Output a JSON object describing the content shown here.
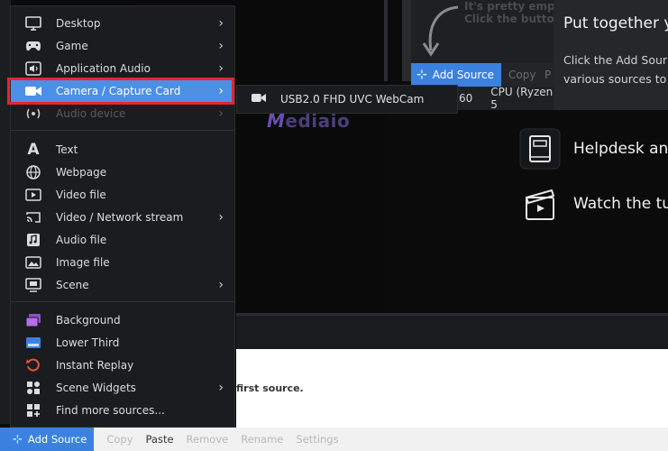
{
  "menu": {
    "items": [
      {
        "label": "Desktop",
        "icon": "monitor-icon",
        "submenu": true
      },
      {
        "label": "Game",
        "icon": "gamepad-icon",
        "submenu": true
      },
      {
        "label": "Application Audio",
        "icon": "speaker-icon",
        "submenu": true
      },
      {
        "label": "Camera / Capture Card",
        "icon": "camera-icon",
        "submenu": true,
        "highlighted": true
      },
      {
        "label": "Audio device",
        "icon": "audio-wave-icon",
        "submenu": true,
        "disabled": true
      },
      {
        "label": "Text",
        "icon": "text-icon"
      },
      {
        "label": "Webpage",
        "icon": "globe-icon"
      },
      {
        "label": "Video file",
        "icon": "video-file-icon"
      },
      {
        "label": "Video / Network stream",
        "icon": "cast-icon",
        "submenu": true
      },
      {
        "label": "Audio file",
        "icon": "music-file-icon"
      },
      {
        "label": "Image file",
        "icon": "image-icon"
      },
      {
        "label": "Scene",
        "icon": "scene-icon",
        "submenu": true
      },
      {
        "label": "Background",
        "icon": "background-icon"
      },
      {
        "label": "Lower Third",
        "icon": "lower-third-icon"
      },
      {
        "label": "Instant Replay",
        "icon": "replay-icon"
      },
      {
        "label": "Scene Widgets",
        "icon": "widgets-icon",
        "submenu": true
      },
      {
        "label": "Find more sources...",
        "icon": "grid-plus-icon"
      }
    ]
  },
  "submenu": {
    "item_label": "USB2.0 FHD UVC WebCam",
    "icon": "camera-icon"
  },
  "sources_panel": {
    "empty_line1": "It's pretty empty",
    "empty_line2": "Click the button",
    "add_source": "Add Source",
    "copy": "Copy",
    "p": "P"
  },
  "stats": {
    "fps": "60",
    "cpu": "CPU (Ryzen 5"
  },
  "welcome": {
    "title": "Put together y",
    "body_line1": "Click the Add Sour",
    "body_line2": "various sources to y"
  },
  "help": {
    "helpdesk": "Helpdesk and",
    "tutorials": "Watch the tut"
  },
  "watermark": {
    "first": "M",
    "rest": "ediaio"
  },
  "main": {
    "hint": "first source."
  },
  "bottom_bar": {
    "add_source": "Add Source",
    "copy": "Copy",
    "paste": "Paste",
    "remove": "Remove",
    "rename": "Rename",
    "settings": "Settings"
  },
  "colors": {
    "accent": "#3b82e0",
    "highlight": "#4d8fe4",
    "annotation": "#e3262c",
    "menu_bg": "#1b1c20"
  }
}
